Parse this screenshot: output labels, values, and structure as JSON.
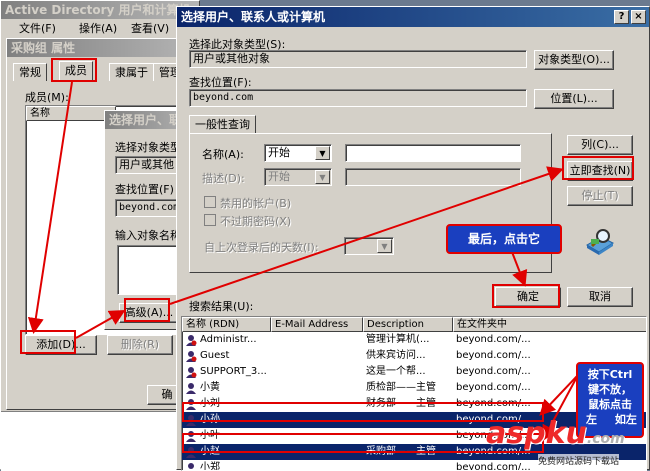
{
  "ad_window": {
    "title": "Active Directory 用户和计算机",
    "menu": [
      "文件(F)",
      "操作(A)",
      "查看(V)"
    ]
  },
  "props_dialog": {
    "title": "采购组 属性",
    "tabs": [
      "常规",
      "成员",
      "隶属于",
      "管理者"
    ],
    "members_label": "成员(M):",
    "col_name": "名称",
    "add_button": "添加(D)...",
    "remove_button": "删除(R)",
    "ok_partial": "确"
  },
  "small_dialog": {
    "title": "选择用户、联",
    "obj_type_label": "选择对象类型",
    "obj_type_value": "用户或其他",
    "location_label": "查找位置(F)",
    "location_value": "beyond.com",
    "enter_label": "输入对象名称",
    "advanced_button": "高级(A)..."
  },
  "main_dialog": {
    "title": "选择用户、联系人或计算机",
    "help_icon": "?",
    "close_icon": "×",
    "obj_type_label": "选择此对象类型(S):",
    "obj_type_value": "用户或其他对象",
    "obj_type_button": "对象类型(O)...",
    "location_label": "查找位置(F):",
    "location_value": "beyond.com",
    "location_button": "位置(L)...",
    "tab_label": "一般性查询",
    "name_label": "名称(A):",
    "name_mode": "开始",
    "desc_label": "描述(D):",
    "desc_mode": "开始",
    "disabled_accounts": "禁用的帐户(B)",
    "non_expiring": "不过期密码(X)",
    "days_since_logon": "自上次登录后的天数(I):",
    "columns_button": "列(C)...",
    "find_now_button": "立即查找(N)",
    "stop_button": "停止(T)",
    "ok_button": "确定",
    "cancel_button": "取消",
    "results_label": "搜索结果(U):",
    "results_headers": [
      "名称 (RDN)",
      "E-Mail Address",
      "Description",
      "在文件夹中"
    ],
    "results": [
      {
        "name": "Administr...",
        "email": "",
        "desc": "管理计算机(...",
        "folder": "beyond.com/...",
        "sel": false
      },
      {
        "name": "Guest",
        "email": "",
        "desc": "供来宾访问...",
        "folder": "beyond.com/...",
        "sel": false
      },
      {
        "name": "SUPPORT_3...",
        "email": "",
        "desc": "这是一个帮...",
        "folder": "beyond.com/...",
        "sel": false
      },
      {
        "name": "小黄",
        "email": "",
        "desc": "质检部——主管",
        "folder": "beyond.com/...",
        "sel": false
      },
      {
        "name": "小刘",
        "email": "",
        "desc": "财务部——主管",
        "folder": "beyond.com/...",
        "sel": false
      },
      {
        "name": "小孙",
        "email": "",
        "desc": "",
        "folder": "beyond.com/...",
        "sel": true
      },
      {
        "name": "小叶",
        "email": "",
        "desc": "",
        "folder": "beyond.com/...",
        "sel": false
      },
      {
        "name": "小赵",
        "email": "",
        "desc": "采购部——主管",
        "folder": "beyond.com/...",
        "sel": true
      },
      {
        "name": "小郑",
        "email": "",
        "desc": "",
        "folder": "beyond.com/...",
        "sel": false
      }
    ]
  },
  "annotations": {
    "callout_1": "最后，点击它",
    "callout_2_lines": [
      "按下Ctrl",
      "键不放，",
      "鼠标点击",
      "左"
    ],
    "callout_2_overlap": "如左"
  },
  "watermark": {
    "brand": "aspku",
    "brand_suffix": ".com",
    "tagline": "免费网站源码下载站"
  },
  "colors": {
    "title_active": "#0a246a",
    "selection": "#0a246a",
    "annotation_red": "#e00000",
    "callout_blue": "#1a3fbf"
  }
}
